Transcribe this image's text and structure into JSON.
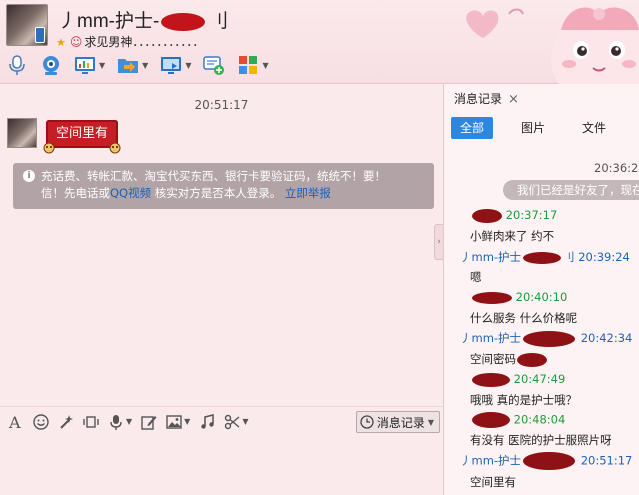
{
  "header": {
    "title_prefix": "丿mm-护士-",
    "title_suffix": "刂",
    "signature": "求见男神．．．．．．．．．．．"
  },
  "toolbar": {
    "buttons": [
      {
        "name": "voice-call",
        "icon": "microphone-icon"
      },
      {
        "name": "video-call",
        "icon": "webcam-icon"
      },
      {
        "name": "remote-desktop",
        "icon": "screen-chart-icon"
      },
      {
        "name": "send-file",
        "icon": "file-transfer-icon"
      },
      {
        "name": "share-screen",
        "icon": "monitor-icon"
      },
      {
        "name": "create-discussion",
        "icon": "add-chat-icon"
      },
      {
        "name": "apps",
        "icon": "apps-grid-icon"
      }
    ]
  },
  "chat": {
    "time": "20:51:17",
    "bubble_text": "空间里有",
    "warning_line1": "充话费、转帐汇款、淘宝代买东西、银行卡要验证码，统统不！要！",
    "warning_line2_a": "信！先电话或",
    "warning_line2_link": "QQ视频",
    "warning_line2_b": "核实对方是否本人登录。",
    "warning_report": "立即举报"
  },
  "input_toolbar": {
    "history_label": "消息记录"
  },
  "history": {
    "title": "消息记录",
    "close": "×",
    "tabs": [
      "全部",
      "图片",
      "文件"
    ],
    "entries": [
      {
        "type": "time",
        "text": "20:36:24"
      },
      {
        "type": "pill",
        "text": "我们已经是好友了，现在"
      },
      {
        "type": "sender",
        "name": "",
        "time": "20:37:17"
      },
      {
        "type": "message",
        "text": "小鲜肉来了 约不"
      },
      {
        "type": "sender",
        "name": "丿mm-护士",
        "suffix": "刂",
        "time": "20:39:24"
      },
      {
        "type": "message",
        "text": "嗯"
      },
      {
        "type": "sender",
        "name": "",
        "time": "20:40:10"
      },
      {
        "type": "message",
        "text": "什么服务 什么价格呢"
      },
      {
        "type": "sender",
        "name": "丿mm-护士",
        "suffix": "",
        "time": "20:42:34"
      },
      {
        "type": "message",
        "text": "空间密码"
      },
      {
        "type": "sender",
        "name": "",
        "time": "20:47:49"
      },
      {
        "type": "message",
        "text": "哦哦 真的是护士哦？"
      },
      {
        "type": "sender",
        "name": "",
        "time": "20:48:04"
      },
      {
        "type": "message",
        "text": "有没有 医院的护士服照片呀"
      },
      {
        "type": "sender",
        "name": "丿mm-护士",
        "suffix": "",
        "time": "20:51:17"
      },
      {
        "type": "message",
        "text": "空间里有"
      }
    ]
  }
}
